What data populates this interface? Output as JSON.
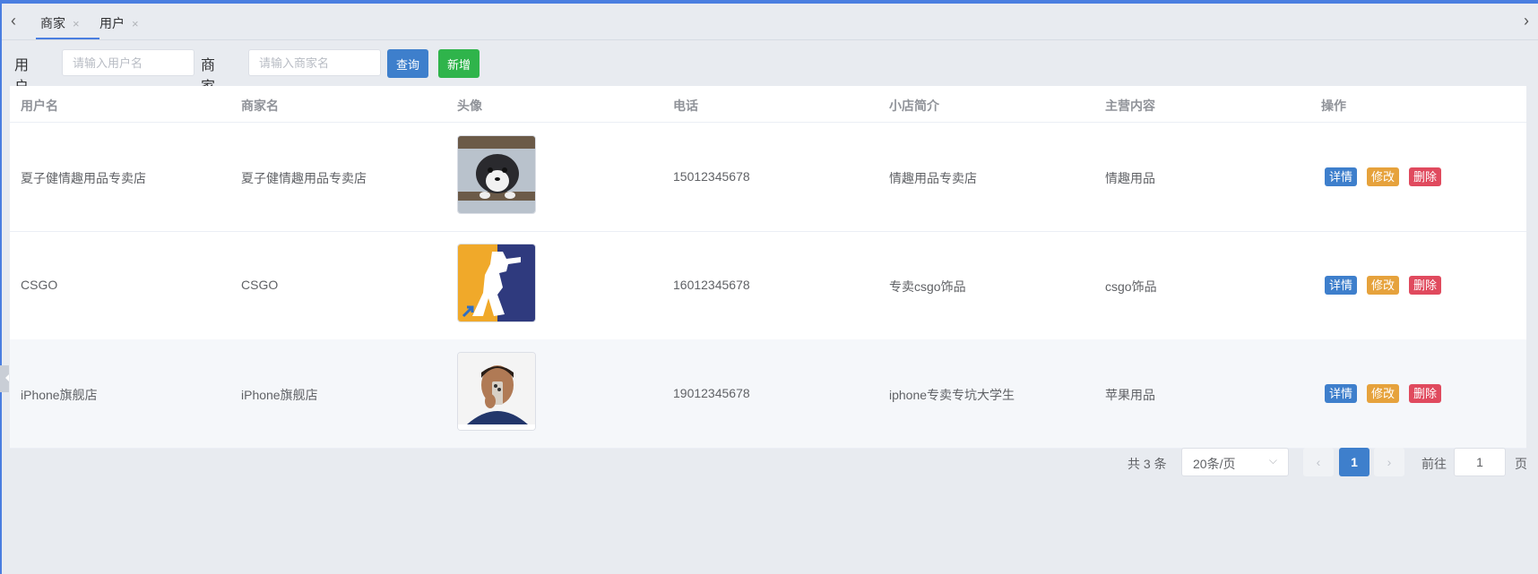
{
  "tabs": [
    {
      "label": "商家",
      "close": "×"
    },
    {
      "label": "用户",
      "close": "×"
    }
  ],
  "search": {
    "username_label": "用户名",
    "username_placeholder": "请输入用户名",
    "shopname_label": "商家名",
    "shopname_placeholder": "请输入商家名",
    "query_label": "查询",
    "add_label": "新增"
  },
  "table": {
    "headers": [
      "用户名",
      "商家名",
      "头像",
      "电话",
      "小店简介",
      "主营内容",
      "操作"
    ],
    "rows": [
      {
        "username": "夏子健情趣用品专卖店",
        "shopname": "夏子健情趣用品专卖店",
        "avatar": "dog-photo",
        "phone": "15012345678",
        "intro": "情趣用品专卖店",
        "main": "情趣用品"
      },
      {
        "username": "CSGO",
        "shopname": "CSGO",
        "avatar": "csgo-logo",
        "phone": "16012345678",
        "intro": "专卖csgo饰品",
        "main": "csgo饰品"
      },
      {
        "username": "iPhone旗舰店",
        "shopname": "iPhone旗舰店",
        "avatar": "man-with-phone-photo",
        "phone": "19012345678",
        "intro": "iphone专卖专坑大学生",
        "main": "苹果用品"
      }
    ],
    "actions": {
      "detail": "详情",
      "edit": "修改",
      "delete": "删除"
    }
  },
  "pagination": {
    "total_text": "共 3 条",
    "page_size": "20条/页",
    "current_page": "1",
    "goto_label": "前往",
    "goto_value": "1",
    "goto_suffix": "页"
  },
  "colors": {
    "accent": "#4a7ee0",
    "primary_button": "#3e7fcc",
    "success_button": "#2fb44b",
    "warning_button": "#e6a23c",
    "danger_button": "#e04a5e"
  }
}
